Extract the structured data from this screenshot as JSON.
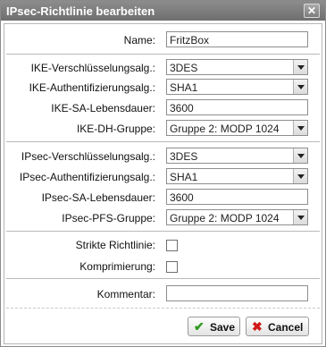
{
  "dialog": {
    "title": "IPsec-Richtlinie bearbeiten",
    "close_glyph": "✕"
  },
  "form": {
    "name": {
      "label": "Name:",
      "value": "FritzBox"
    },
    "ike_encryption": {
      "label": "IKE-Verschlüsselungsalg.:",
      "value": "3DES"
    },
    "ike_auth": {
      "label": "IKE-Authentifizierungsalg.:",
      "value": "SHA1"
    },
    "ike_sa_lifetime": {
      "label": "IKE-SA-Lebensdauer:",
      "value": "3600"
    },
    "ike_dh_group": {
      "label": "IKE-DH-Gruppe:",
      "value": "Gruppe 2: MODP 1024"
    },
    "ipsec_encryption": {
      "label": "IPsec-Verschlüsselungsalg.:",
      "value": "3DES"
    },
    "ipsec_auth": {
      "label": "IPsec-Authentifizierungsalg.:",
      "value": "SHA1"
    },
    "ipsec_sa_lifetime": {
      "label": "IPsec-SA-Lebensdauer:",
      "value": "3600"
    },
    "ipsec_pfs_group": {
      "label": "IPsec-PFS-Gruppe:",
      "value": "Gruppe 2: MODP 1024"
    },
    "strict_policy": {
      "label": "Strikte Richtlinie:",
      "checked": false
    },
    "compression": {
      "label": "Komprimierung:",
      "checked": false
    },
    "comment": {
      "label": "Kommentar:",
      "value": ""
    }
  },
  "buttons": {
    "save": {
      "label": "Save",
      "icon": "checkmark-icon",
      "color": "#2e9a1e"
    },
    "cancel": {
      "label": "Cancel",
      "icon": "x-icon",
      "color": "#d01818"
    }
  }
}
